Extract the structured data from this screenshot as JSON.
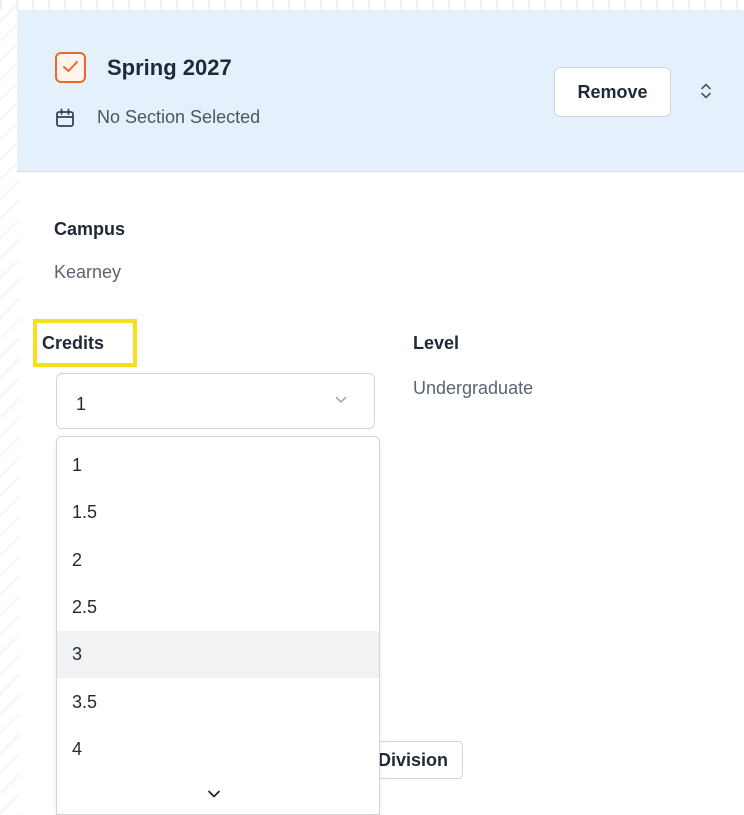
{
  "header": {
    "term_title": "Spring 2027",
    "checkbox_checked": true,
    "section_status": "No Section Selected",
    "remove_label": "Remove",
    "accent_color": "#e36b2c",
    "background_color": "#e5f0fd",
    "icons": [
      "check-icon",
      "calendar-icon",
      "sort-updown-icon"
    ]
  },
  "details": {
    "campus_label": "Campus",
    "campus_value": "Kearney",
    "credits_label": "Credits",
    "credits_selected": "1",
    "level_label": "Level",
    "level_value": "Undergraduate",
    "division_label": "Division"
  },
  "dropdown": {
    "options": [
      "1",
      "1.5",
      "2",
      "2.5",
      "3",
      "3.5",
      "4"
    ],
    "hovered_option": "3"
  }
}
